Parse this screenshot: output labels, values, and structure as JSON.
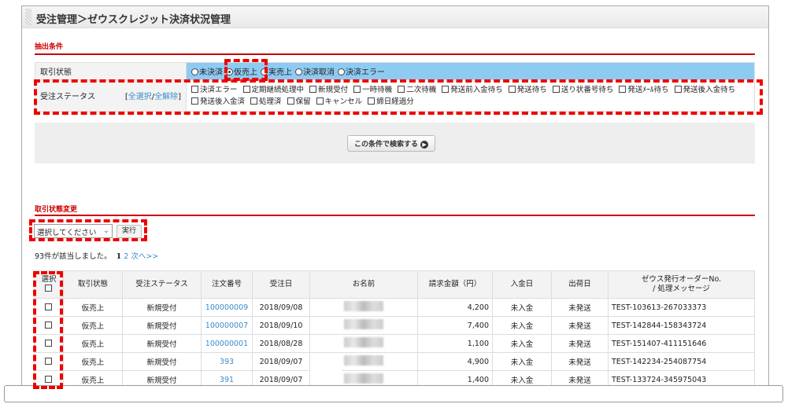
{
  "title": "受注管理＞ゼウスクレジット決済状況管理",
  "extract": {
    "section_label": "抽出条件",
    "trans_state_label": "取引状態",
    "trans_states": [
      {
        "label": "未決済",
        "checked": false
      },
      {
        "label": "仮売上",
        "checked": true
      },
      {
        "label": "実売上",
        "checked": false
      },
      {
        "label": "決済取消",
        "checked": false
      },
      {
        "label": "決済エラー",
        "checked": false
      }
    ],
    "order_status_label": "受注ステータス",
    "select_all": "全選択",
    "deselect_all": "全解除",
    "order_statuses": [
      "決済エラー",
      "定期継続処理中",
      "新規受付",
      "一時待機",
      "二次待機",
      "発送前入金待ち",
      "発送待ち",
      "送り状番号待ち",
      "発送ﾒｰﾙ待ち",
      "発送後入金待ち",
      "発送後入金済",
      "処理済",
      "保留",
      "キャンセル",
      "締日経過分"
    ],
    "search_button": "この条件で検索する"
  },
  "change": {
    "section_label": "取引状態変更",
    "select_value": "選択してください",
    "execute_button": "実行"
  },
  "results": {
    "count_text": "93件が該当しました。",
    "current_page": "1",
    "next_page": "2",
    "next_link": "次へ>>",
    "headers": [
      "選択",
      "取引状態",
      "受注ステータス",
      "注文番号",
      "受注日",
      "お名前",
      "請求金額（円）",
      "入金日",
      "出荷日",
      "ゼウス発行オーダーNo.",
      "/ 処理メッセージ"
    ],
    "rows": [
      {
        "state": "仮売上",
        "status": "新規受付",
        "order_no": "100000009",
        "date": "2018/09/08",
        "amount": "4,200",
        "paid": "未入金",
        "shipped": "未発送",
        "zeus": "TEST-103613-267033373"
      },
      {
        "state": "仮売上",
        "status": "新規受付",
        "order_no": "100000007",
        "date": "2018/09/10",
        "amount": "7,400",
        "paid": "未入金",
        "shipped": "未発送",
        "zeus": "TEST-142844-158343724"
      },
      {
        "state": "仮売上",
        "status": "新規受付",
        "order_no": "100000001",
        "date": "2018/08/28",
        "amount": "1,100",
        "paid": "未入金",
        "shipped": "未発送",
        "zeus": "TEST-151407-411151646"
      },
      {
        "state": "仮売上",
        "status": "新規受付",
        "order_no": "393",
        "date": "2018/09/07",
        "amount": "4,900",
        "paid": "未入金",
        "shipped": "未発送",
        "zeus": "TEST-142234-254087754"
      },
      {
        "state": "仮売上",
        "status": "新規受付",
        "order_no": "391",
        "date": "2018/09/07",
        "amount": "1,400",
        "paid": "未入金",
        "shipped": "未発送",
        "zeus": "TEST-133724-345975043"
      }
    ]
  },
  "colors": {
    "accent": "#cc0000",
    "highlight_row": "#8ecbf3",
    "link": "#3a8cc8",
    "annotation": "#ee0000"
  }
}
